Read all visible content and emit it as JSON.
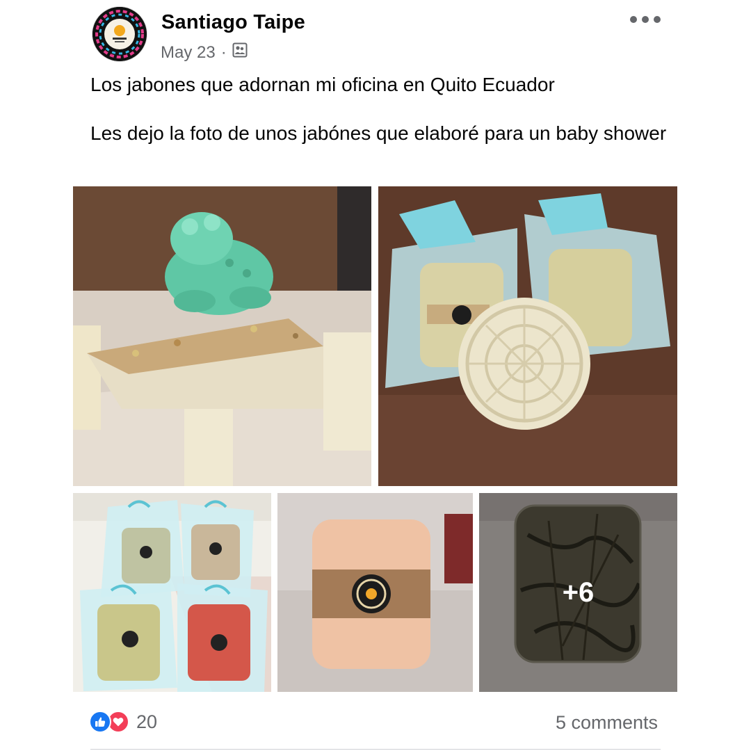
{
  "post": {
    "author": "Santiago Taipe",
    "date": "May 23",
    "separator": "·",
    "audience_icon": "friends-album-icon",
    "more_icon": "more-horizontal-icon",
    "text_line1": "Los jabones que adornan mi oficina en Quito Ecuador",
    "text_line2": "Les dejo la foto de unos jabónes que elaboré para un baby shower",
    "photos": [
      {
        "subject": "frog soap on chamomile soap block"
      },
      {
        "subject": "soaps in blue organza bags with round embossed soap"
      },
      {
        "subject": "four soaps in blue organza bags"
      },
      {
        "subject": "cream soap bar with brown label band"
      },
      {
        "subject": "clear soap with dried herbs",
        "more_count": "+6"
      }
    ],
    "reactions": {
      "icons": [
        "like-icon",
        "love-icon"
      ],
      "count": "20"
    },
    "comments_label": "5 comments"
  },
  "colors": {
    "text_primary": "#050505",
    "text_secondary": "#65676b",
    "like_blue": "#1877f2",
    "love_red": "#f33e58",
    "divider": "#ced0d4"
  }
}
